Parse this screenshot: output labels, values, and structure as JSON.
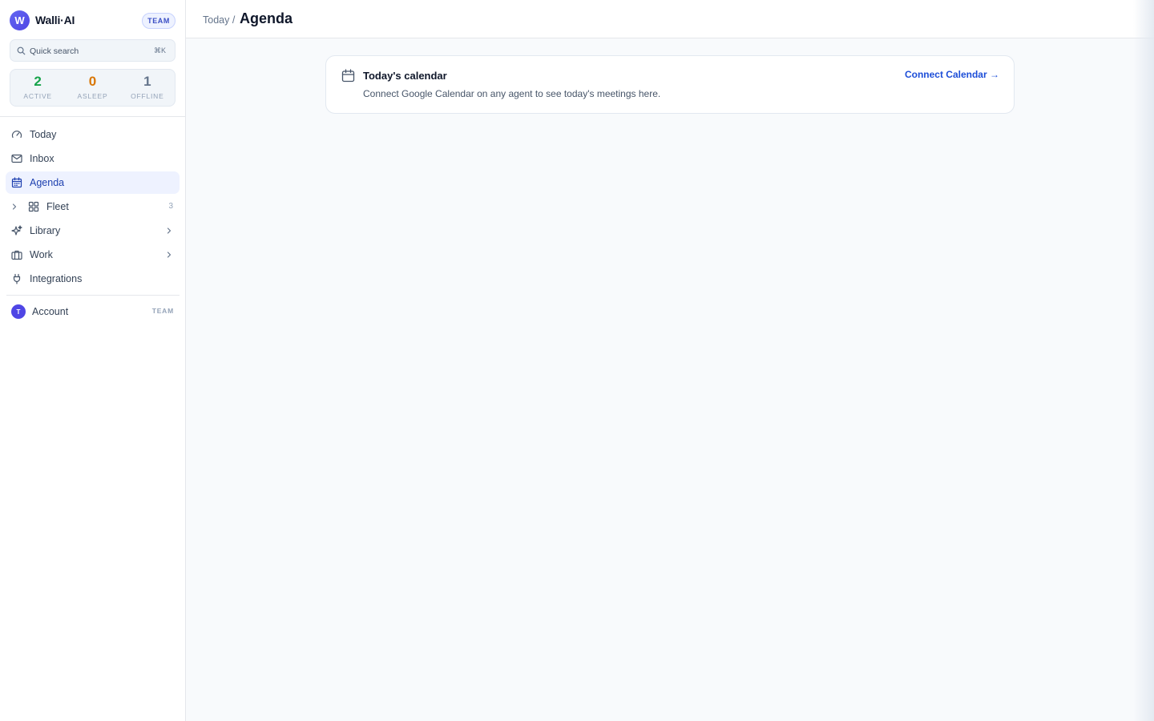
{
  "brand": {
    "logo_letter": "W",
    "name": "Walli·AI",
    "plan_badge": "TEAM"
  },
  "search": {
    "placeholder": "Quick search",
    "shortcut": "⌘K"
  },
  "stats": [
    {
      "value": "2",
      "label": "ACTIVE",
      "color": "#16a34a"
    },
    {
      "value": "0",
      "label": "ASLEEP",
      "color": "#d97706"
    },
    {
      "value": "1",
      "label": "OFFLINE",
      "color": "#64748b"
    }
  ],
  "nav": {
    "today": "Today",
    "inbox": "Inbox",
    "agenda": "Agenda",
    "fleet": "Fleet",
    "fleet_count": "3",
    "library": "Library",
    "work": "Work",
    "integrations": "Integrations"
  },
  "account": {
    "avatar_letter": "T",
    "label": "Account",
    "badge": "TEAM"
  },
  "header": {
    "breadcrumb": "Today /",
    "title": "Agenda"
  },
  "calendar_card": {
    "title": "Today's calendar",
    "description": "Connect Google Calendar on any agent to see today's meetings here.",
    "action": "Connect Calendar →"
  }
}
